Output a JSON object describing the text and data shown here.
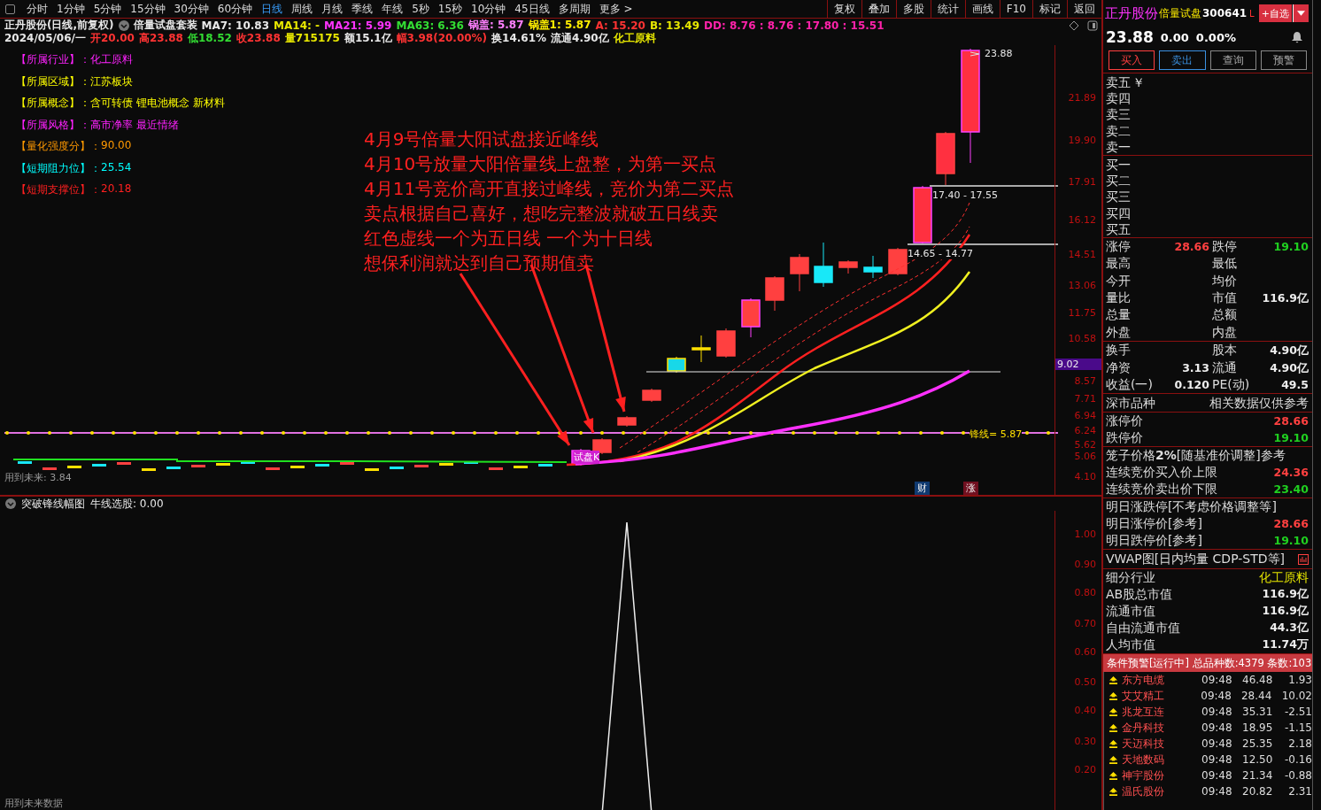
{
  "toolbar": {
    "periods": [
      {
        "label": "分时",
        "selected": false
      },
      {
        "label": "1分钟",
        "selected": false
      },
      {
        "label": "5分钟",
        "selected": false
      },
      {
        "label": "15分钟",
        "selected": false
      },
      {
        "label": "30分钟",
        "selected": false
      },
      {
        "label": "60分钟",
        "selected": false
      },
      {
        "label": "日线",
        "selected": true
      },
      {
        "label": "周线",
        "selected": false
      },
      {
        "label": "月线",
        "selected": false
      },
      {
        "label": "季线",
        "selected": false
      },
      {
        "label": "年线",
        "selected": false
      },
      {
        "label": "5秒",
        "selected": false
      },
      {
        "label": "15秒",
        "selected": false
      },
      {
        "label": "10分钟",
        "selected": false
      },
      {
        "label": "45日线",
        "selected": false
      },
      {
        "label": "多周期",
        "selected": false
      },
      {
        "label": "更多 >",
        "selected": false
      }
    ],
    "actions": [
      "复权",
      "叠加",
      "多股",
      "统计",
      "画线",
      "F10",
      "标记",
      "返回"
    ]
  },
  "indicator_line": {
    "title": "正丹股份(日线,前复权)",
    "set_name": "倍量试盘套装",
    "values": [
      {
        "text": "MA7: 10.83",
        "color": "#e8e8e8"
      },
      {
        "text": "MA14: -",
        "color": "#e8e800"
      },
      {
        "text": "MA21: 5.99",
        "color": "#ff33ff"
      },
      {
        "text": "MA63: 6.36",
        "color": "#33dd33"
      },
      {
        "text": "锅盖: 5.87",
        "color": "#ff80ff"
      },
      {
        "text": "锅盖1: 5.87",
        "color": "#ffee00"
      },
      {
        "text": "A: 15.20",
        "color": "#ff3333"
      },
      {
        "text": "B: 13.49",
        "color": "#e8e800"
      },
      {
        "text": "DD: 8.76 : 8.76 : 17.80 : 15.51",
        "color": "#ff22aa"
      }
    ]
  },
  "quote_line": [
    {
      "text": "2024/05/06/一",
      "color": "#e8e8e8"
    },
    {
      "text": "开20.00",
      "color": "#ff3333"
    },
    {
      "text": "高23.88",
      "color": "#ff3333"
    },
    {
      "text": "低18.52",
      "color": "#33dd33"
    },
    {
      "text": "收23.88",
      "color": "#ff3333"
    },
    {
      "text": "量715175",
      "color": "#e8e800"
    },
    {
      "text": "额15.1亿",
      "color": "#e8e8e8"
    },
    {
      "text": "幅3.98(20.00%)",
      "color": "#ff3333"
    },
    {
      "text": "换14.61%",
      "color": "#e8e8e8"
    },
    {
      "text": "流通4.90亿",
      "color": "#e8e8e8"
    },
    {
      "text": "化工原料",
      "color": "#e8e800"
    }
  ],
  "stock_info": [
    {
      "label": "【所属行业】：",
      "value": "化工原料",
      "color": "#ff22ff"
    },
    {
      "label": "【所属区域】：",
      "value": "江苏板块",
      "color": "#ffff00"
    },
    {
      "label": "【所属概念】：",
      "value": "含可转债 锂电池概念 新材料",
      "color": "#ffff00"
    },
    {
      "label": "【所属风格】：",
      "value": "高市净率 最近情绪",
      "color": "#ff22ff"
    },
    {
      "label": "【量化强度分】：",
      "value": "90.00",
      "color": "#ff9900"
    },
    {
      "label": "【短期阻力位】：",
      "value": "25.54",
      "color": "#00ffff"
    },
    {
      "label": "【短期支撑位】：",
      "value": "20.18",
      "color": "#ff2020"
    }
  ],
  "annotation": [
    "4月9号倍量大阳试盘接近峰线",
    "4月10号放量大阳倍量线上盘整，为第一买点",
    "4月11号竞价高开直接过峰线，竞价为第二买点",
    "卖点根据自己喜好，想吃完整波就破五日线卖",
    "红色虚线一个为五日线  一个为十日线",
    "想保利润就达到自己预期值卖"
  ],
  "chart_labels": {
    "peak": "23.88",
    "upper_range": "17.40 - 17.55",
    "lower_range": "14.65 - 14.77",
    "feng_line": "锋线= 5.87",
    "future": "用到未来: 3.84",
    "trial": "试盘K",
    "badges": [
      "财",
      "涨"
    ]
  },
  "price_axis": [
    {
      "label": "21.89",
      "highlighted": false
    },
    {
      "label": "19.90",
      "highlighted": false
    },
    {
      "label": "17.91",
      "highlighted": false
    },
    {
      "label": "16.12",
      "highlighted": false
    },
    {
      "label": "14.51",
      "highlighted": false
    },
    {
      "label": "13.06",
      "highlighted": false
    },
    {
      "label": "11.75",
      "highlighted": false
    },
    {
      "label": "10.58",
      "highlighted": false
    },
    {
      "label": "9.02",
      "highlighted": true
    },
    {
      "label": "8.57",
      "highlighted": false
    },
    {
      "label": "7.71",
      "highlighted": false
    },
    {
      "label": "6.94",
      "highlighted": false
    },
    {
      "label": "6.24",
      "highlighted": false
    },
    {
      "label": "5.62",
      "highlighted": false
    },
    {
      "label": "5.06",
      "highlighted": false
    },
    {
      "label": "4.10",
      "highlighted": false
    }
  ],
  "sub_chart": {
    "title": "突破锋线幅图",
    "reading": "牛线选股: 0.00",
    "axis": [
      "1.00",
      "0.90",
      "0.80",
      "0.70",
      "0.60",
      "0.50",
      "0.40",
      "0.30",
      "0.20"
    ],
    "footer": "用到未来数据"
  },
  "side": {
    "name": "正丹股份",
    "tag": "倍量试盘",
    "code": "300641",
    "market": "L",
    "watch_button": "+自选",
    "price": "23.88",
    "change": "0.00",
    "change_pct": "0.00%",
    "trade_buttons": [
      "买入",
      "卖出",
      "查询",
      "预警"
    ],
    "asks": [
      "卖五",
      "卖四",
      "卖三",
      "卖二",
      "卖一"
    ],
    "currency_mark": "￥",
    "bids": [
      "买一",
      "买二",
      "买三",
      "买四",
      "买五"
    ],
    "stats": [
      {
        "cells": [
          {
            "label": "涨停",
            "value": "28.66",
            "color": "#ff4040"
          },
          {
            "label": "跌停",
            "value": "19.10",
            "color": "#20d020"
          }
        ]
      },
      {
        "cells": [
          {
            "label": "最高"
          },
          {
            "label": "最低"
          }
        ]
      },
      {
        "cells": [
          {
            "label": "今开"
          },
          {
            "label": "均价"
          }
        ]
      },
      {
        "cells": [
          {
            "label": "量比"
          },
          {
            "label": "市值",
            "value": "116.9亿",
            "color": "#eeeeee"
          }
        ]
      },
      {
        "cells": [
          {
            "label": "总量"
          },
          {
            "label": "总额"
          }
        ]
      },
      {
        "cells": [
          {
            "label": "外盘"
          },
          {
            "label": "内盘"
          }
        ]
      }
    ],
    "stats2": [
      {
        "cells": [
          {
            "label": "换手"
          },
          {
            "label": "股本",
            "value": "4.90亿",
            "color": "#eeeeee"
          }
        ]
      },
      {
        "cells": [
          {
            "label": "净资",
            "value": "3.13",
            "color": "#eeeeee"
          },
          {
            "label": "流通",
            "value": "4.90亿",
            "color": "#eeeeee"
          }
        ]
      },
      {
        "cells": [
          {
            "label": "收益(一)",
            "value": "0.120",
            "color": "#eeeeee"
          },
          {
            "label": "PE(动)",
            "value": "49.5",
            "color": "#eeeeee"
          }
        ]
      }
    ],
    "market_kind": "深市品种",
    "market_note": "相关数据仅供参考",
    "limits": [
      {
        "label": "涨停价",
        "value": "28.66",
        "color": "#ff4040"
      },
      {
        "label": "跌停价",
        "value": "19.10",
        "color": "#20d020"
      }
    ],
    "cage_title": "笼子价格**2%**[随基准价调整]参考",
    "cage": [
      {
        "label": "连续竞价买入价上限",
        "value": "24.36",
        "color": "#ff4040"
      },
      {
        "label": "连续竞价卖出价下限",
        "value": "23.40",
        "color": "#20d020"
      }
    ],
    "tomorrow_title": "明日涨跌停[不考虑价格调整等]",
    "tomorrow": [
      {
        "label": "明日涨停价[参考]",
        "value": "28.66",
        "color": "#ff4040"
      },
      {
        "label": "明日跌停价[参考]",
        "value": "19.10",
        "color": "#20d020"
      }
    ],
    "vwap": "VWAP图[日内均量 CDP-STD等]",
    "industry": {
      "label": "细分行业",
      "value": "化工原料"
    },
    "values": [
      {
        "label": "AB股总市值",
        "value": "116.9亿"
      },
      {
        "label": "流通市值",
        "value": "116.9亿"
      },
      {
        "label": "自由流通市值",
        "value": "44.3亿"
      },
      {
        "label": "人均市值",
        "value": "11.74万"
      }
    ],
    "alert_header": "条件预警[运行中] 总品种数:4379 条数:103",
    "alerts": [
      {
        "name": "东方电缆",
        "time": "09:48",
        "price": "46.48",
        "pct": "1.93"
      },
      {
        "name": "艾艾精工",
        "time": "09:48",
        "price": "28.44",
        "pct": "10.02"
      },
      {
        "name": "兆龙互连",
        "time": "09:48",
        "price": "35.31",
        "pct": "-2.51"
      },
      {
        "name": "金丹科技",
        "time": "09:48",
        "price": "18.95",
        "pct": "-1.15"
      },
      {
        "name": "天迈科技",
        "time": "09:48",
        "price": "25.35",
        "pct": "2.18"
      },
      {
        "name": "天地数码",
        "time": "09:48",
        "price": "12.50",
        "pct": "-0.16"
      },
      {
        "name": "神宇股份",
        "time": "09:48",
        "price": "21.34",
        "pct": "-0.88"
      },
      {
        "name": "温氏股份",
        "time": "09:48",
        "price": "20.82",
        "pct": "2.31"
      }
    ]
  }
}
